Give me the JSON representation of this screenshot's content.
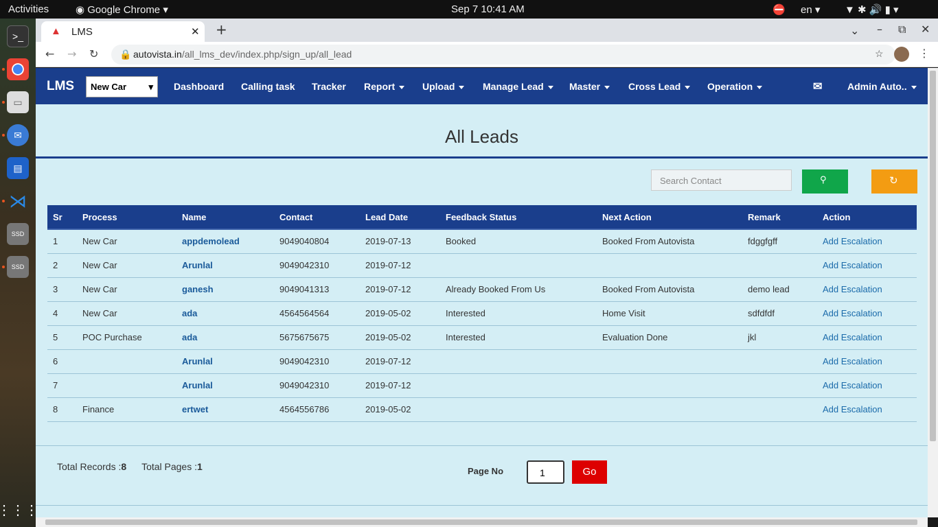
{
  "system": {
    "activities": "Activities",
    "app": "Google Chrome",
    "datetime": "Sep 7  10:41 AM",
    "lang": "en"
  },
  "browser": {
    "tab_title": "LMS",
    "url_host": "autovista.in",
    "url_path": "/all_lms_dev/index.php/sign_up/all_lead"
  },
  "nav": {
    "brand": "LMS",
    "process_select": "New Car",
    "items": [
      "Dashboard",
      "Calling task",
      "Tracker",
      "Report",
      "Upload",
      "Manage Lead",
      "Master",
      "Cross Lead",
      "Operation"
    ],
    "user": "Admin Auto.."
  },
  "page": {
    "title": "All Leads",
    "search_placeholder": "Search Contact"
  },
  "table": {
    "headers": [
      "Sr",
      "Process",
      "Name",
      "Contact",
      "Lead Date",
      "Feedback Status",
      "Next Action",
      "Remark",
      "Action"
    ],
    "rows": [
      [
        "1",
        "New Car",
        "appdemolead",
        "9049040804",
        "2019-07-13",
        "Booked",
        "Booked From Autovista",
        "fdggfgff",
        "Add Escalation"
      ],
      [
        "2",
        "New Car",
        "Arunlal",
        "9049042310",
        "2019-07-12",
        "",
        "",
        "",
        "Add Escalation"
      ],
      [
        "3",
        "New Car",
        "ganesh",
        "9049041313",
        "2019-07-12",
        "Already Booked From Us",
        "Booked From Autovista",
        "demo lead",
        "Add Escalation"
      ],
      [
        "4",
        "New Car",
        "ada",
        "4564564564",
        "2019-05-02",
        "Interested",
        "Home Visit",
        "sdfdfdf",
        "Add Escalation"
      ],
      [
        "5",
        "POC Purchase",
        "ada",
        "5675675675",
        "2019-05-02",
        "Interested",
        "Evaluation Done",
        "jkl",
        "Add Escalation"
      ],
      [
        "6",
        "",
        "Arunlal",
        "9049042310",
        "2019-07-12",
        "",
        "",
        "",
        "Add Escalation"
      ],
      [
        "7",
        "",
        "Arunlal",
        "9049042310",
        "2019-07-12",
        "",
        "",
        "",
        "Add Escalation"
      ],
      [
        "8",
        "Finance",
        "ertwet",
        "4564556786",
        "2019-05-02",
        "",
        "",
        "",
        "Add Escalation"
      ]
    ]
  },
  "footer": {
    "total_records_label": "Total Records :",
    "total_records": "8",
    "total_pages_label": "Total Pages :",
    "total_pages": "1",
    "page_no_label": "Page No",
    "page_value": "1",
    "go_label": "Go"
  }
}
